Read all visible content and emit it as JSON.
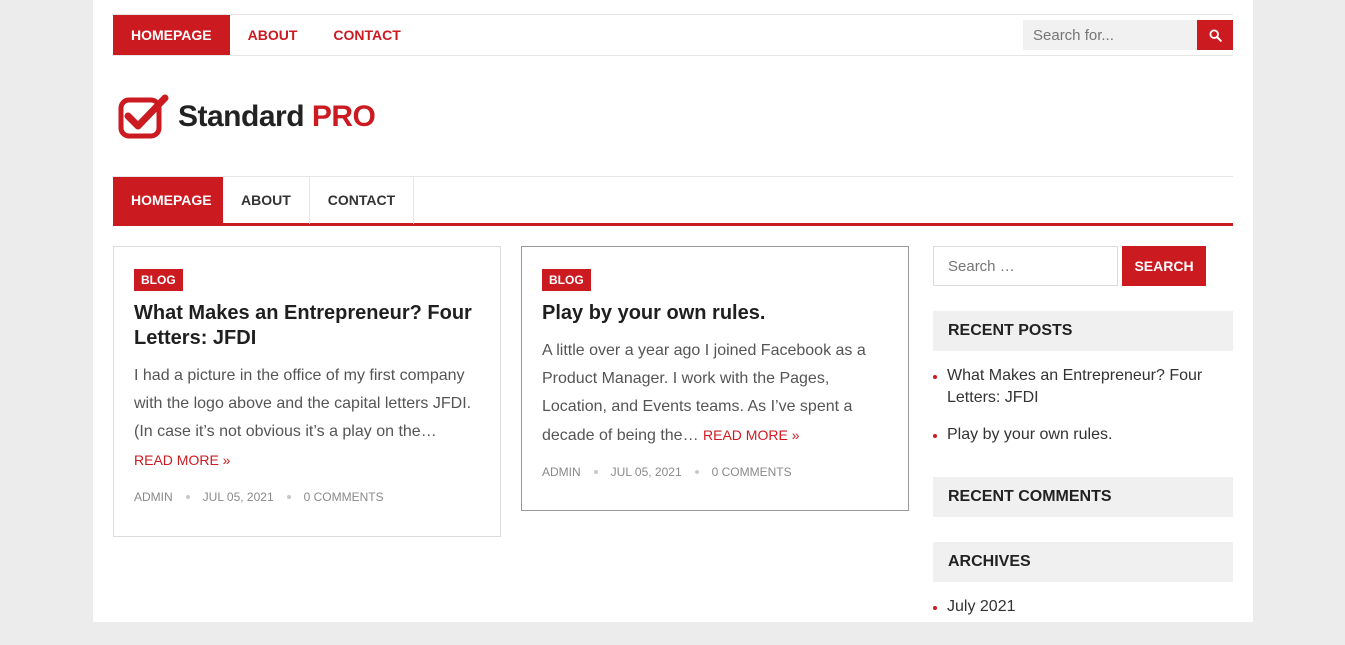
{
  "colors": {
    "accent": "#cc1a21",
    "page_bg": "#ececec"
  },
  "top_nav": {
    "items": [
      {
        "label": "HOMEPAGE",
        "active": true
      },
      {
        "label": "ABOUT",
        "active": false
      },
      {
        "label": "CONTACT",
        "active": false
      }
    ],
    "search_placeholder": "Search for...",
    "search_icon": "search-icon"
  },
  "logo": {
    "name": "Standard",
    "suffix": "PRO",
    "icon": "checkbox-check-icon"
  },
  "main_nav": {
    "items": [
      {
        "label": "HOMEPAGE",
        "active": true
      },
      {
        "label": "ABOUT",
        "active": false
      },
      {
        "label": "CONTACT",
        "active": false
      }
    ]
  },
  "posts": [
    {
      "category": "BLOG",
      "title": "What Makes an Entrepreneur? Four Letters: JFDI",
      "excerpt": "I had a picture in the office of my first company with the logo above and the capital letters JFDI. (In case it’s not obvious it’s a play on the…",
      "read_more": "READ MORE »",
      "author": "ADMIN",
      "date": "JUL 05, 2021",
      "comments": "0 COMMENTS"
    },
    {
      "category": "BLOG",
      "title": "Play by your own rules.",
      "excerpt": "A little over a year ago I joined Facebook as a Product Manager. I work with the Pages, Location, and Events teams. As I’ve spent a decade of being the…",
      "read_more": "READ MORE »",
      "author": "ADMIN",
      "date": "JUL 05, 2021",
      "comments": "0 COMMENTS"
    }
  ],
  "sidebar": {
    "search_placeholder": "Search …",
    "search_button": "SEARCH",
    "recent_posts_title": "RECENT POSTS",
    "recent_posts": [
      "What Makes an Entrepreneur? Four Letters: JFDI",
      "Play by your own rules."
    ],
    "recent_comments_title": "RECENT COMMENTS",
    "archives_title": "ARCHIVES",
    "archives": [
      "July 2021"
    ]
  }
}
